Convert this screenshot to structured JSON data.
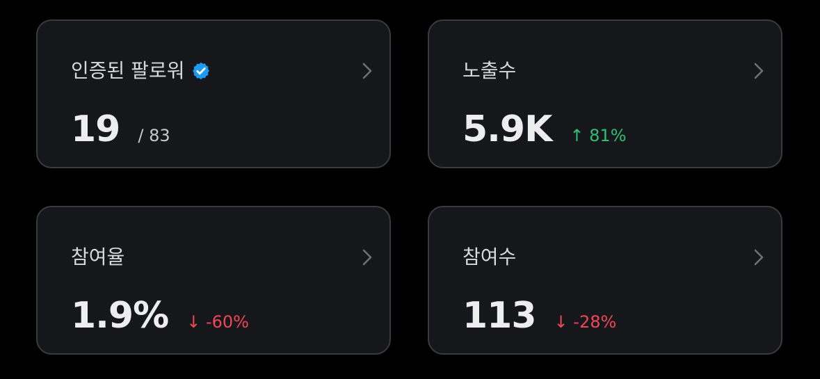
{
  "cards": [
    {
      "title": "인증된 팔로워",
      "value": "19",
      "sub": "/ 83"
    },
    {
      "title": "노출수",
      "value": "5.9K",
      "delta": "↑ 81%",
      "delta_color": "#2fbf71"
    },
    {
      "title": "참여율",
      "value": "1.9%",
      "delta": "↓ -60%",
      "delta_color": "#f0465a"
    },
    {
      "title": "참여수",
      "value": "113",
      "delta": "↓ -28%",
      "delta_color": "#f0465a"
    }
  ],
  "icons": {
    "verified": "verified-badge-icon",
    "chevron": "chevron-right-icon"
  },
  "colors": {
    "background": "#000000",
    "card_background": "#16171b",
    "card_border": "#3a3b40",
    "verified_blue": "#1d9bf0"
  }
}
